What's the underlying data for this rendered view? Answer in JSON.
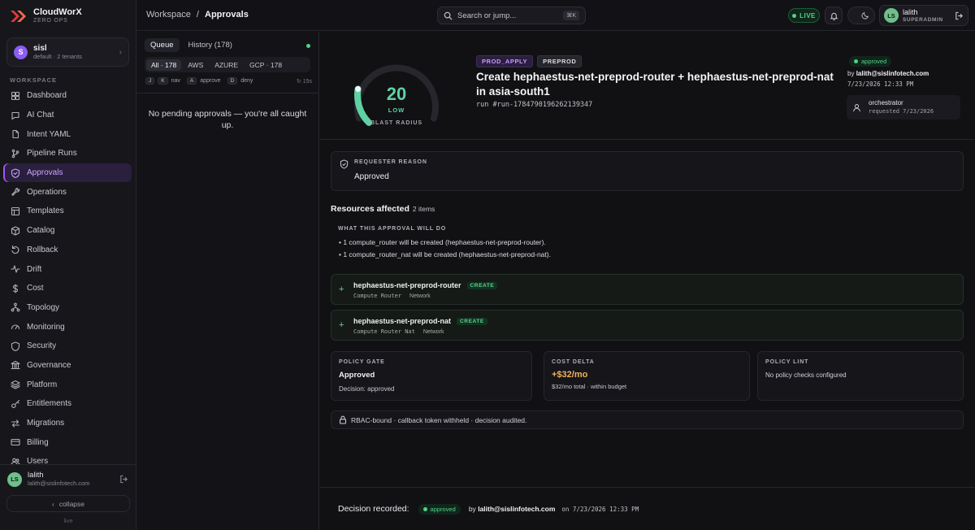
{
  "brand": {
    "name": "CloudWorX",
    "sub": "ZERO OPS"
  },
  "tenant": {
    "initial": "S",
    "name": "sisl",
    "sub": "default · 2 tenants"
  },
  "sidebar": {
    "section": "WORKSPACE",
    "items": [
      {
        "label": "Dashboard",
        "icon": "dashboard-icon"
      },
      {
        "label": "AI Chat",
        "icon": "chat-icon"
      },
      {
        "label": "Intent YAML",
        "icon": "file-icon"
      },
      {
        "label": "Pipeline Runs",
        "icon": "git-branch-icon"
      },
      {
        "label": "Approvals",
        "icon": "shield-icon",
        "active": true
      },
      {
        "label": "Operations",
        "icon": "wrench-icon"
      },
      {
        "label": "Templates",
        "icon": "template-icon"
      },
      {
        "label": "Catalog",
        "icon": "box-icon"
      },
      {
        "label": "Rollback",
        "icon": "rollback-icon"
      },
      {
        "label": "Drift",
        "icon": "activity-icon"
      },
      {
        "label": "Cost",
        "icon": "dollar-icon"
      },
      {
        "label": "Topology",
        "icon": "network-icon"
      },
      {
        "label": "Monitoring",
        "icon": "gauge-icon"
      },
      {
        "label": "Security",
        "icon": "lock-shield-icon"
      },
      {
        "label": "Governance",
        "icon": "bank-icon"
      },
      {
        "label": "Platform",
        "icon": "layers-icon"
      },
      {
        "label": "Entitlements",
        "icon": "key-icon"
      },
      {
        "label": "Migrations",
        "icon": "arrows-icon"
      },
      {
        "label": "Billing",
        "icon": "card-icon"
      },
      {
        "label": "Users",
        "icon": "users-icon"
      }
    ],
    "user": {
      "initials": "LS",
      "name": "lalith",
      "email": "lalith@sislinfotech.com"
    },
    "collapse_label": "collapse",
    "footer": "live"
  },
  "topbar": {
    "crumb_root": "Workspace",
    "crumb_sep": "/",
    "crumb_current": "Approvals",
    "search_placeholder": "Search or jump...",
    "search_kbd": "⌘K",
    "live": "LIVE",
    "user": {
      "initials": "LS",
      "name": "lalith",
      "role": "SUPERADMIN"
    }
  },
  "queue": {
    "tabs": [
      "Queue",
      "History (178)"
    ],
    "filters": [
      "All · 178",
      "AWS",
      "AZURE",
      "GCP · 178"
    ],
    "shortcuts": [
      {
        "key": "J",
        "label": ""
      },
      {
        "key": "K",
        "label": "nav"
      },
      {
        "key": "A",
        "label": "approve"
      },
      {
        "key": "D",
        "label": "deny"
      }
    ],
    "refresh": "15s",
    "empty": "No pending approvals — you're all caught up."
  },
  "detail": {
    "gauge": {
      "value": "20",
      "level": "LOW",
      "caption": "BLAST RADIUS",
      "fraction": 0.2
    },
    "tags": [
      "PROD_APPLY",
      "PREPROD"
    ],
    "title": "Create hephaestus-net-preprod-router + hephaestus-net-preprod-nat in asia-south1",
    "run": "run #run-1784790196262139347",
    "status": "approved",
    "by_prefix": "by",
    "by": "lalith@sislinfotech.com",
    "by_date": "7/23/2026 12:33 PM",
    "orchestrator": {
      "name": "orchestrator",
      "sub": "requested 7/23/2026"
    },
    "reason": {
      "label": "REQUESTER REASON",
      "value": "Approved"
    },
    "resources_title": "Resources affected",
    "resources_count": "2 items",
    "will_do": {
      "label": "WHAT THIS APPROVAL WILL DO",
      "lines": [
        "• 1 compute_router will be created (hephaestus-net-preprod-router).",
        "• 1 compute_router_nat will be created (hephaestus-net-preprod-nat)."
      ]
    },
    "resources": [
      {
        "name": "hephaestus-net-preprod-router",
        "badge": "CREATE",
        "type": "Compute Router",
        "category": "Network"
      },
      {
        "name": "hephaestus-net-preprod-nat",
        "badge": "CREATE",
        "type": "Compute Router Nat",
        "category": "Network"
      }
    ],
    "policy_gate": {
      "label": "POLICY GATE",
      "value": "Approved",
      "sub": "Decision: approved"
    },
    "cost_delta": {
      "label": "COST DELTA",
      "value": "+$32/mo",
      "sub": "$32/mo total · within budget"
    },
    "policy_lint": {
      "label": "POLICY LINT",
      "value": "No policy checks configured"
    },
    "rbac": "RBAC-bound · callback token withheld · decision audited.",
    "decision": {
      "label": "Decision recorded:",
      "status": "approved",
      "by_prefix": "by",
      "by": "lalith@sislinfotech.com",
      "on": "on 7/23/2026 12:33 PM"
    }
  },
  "colors": {
    "accent": "#a855f7",
    "success": "#53d18b",
    "cost": "#f0b35a",
    "gauge_low": "#5fd1a2"
  }
}
